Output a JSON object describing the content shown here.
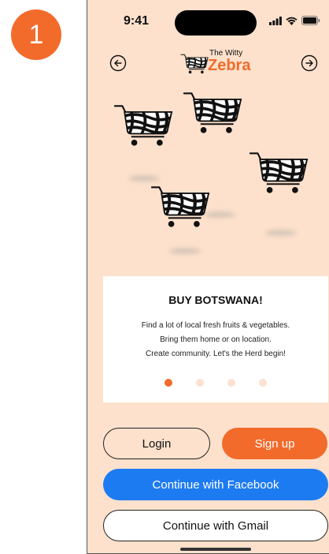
{
  "step_badge": {
    "number": "1",
    "color": "#f26b2b"
  },
  "status_bar": {
    "time": "9:41",
    "icons": [
      "signal-icon",
      "wifi-icon",
      "battery-icon"
    ]
  },
  "nav": {
    "back_icon": "arrow-left-circle-icon",
    "forward_icon": "arrow-right-circle-icon"
  },
  "logo": {
    "small_text": "The Witty",
    "big_text": "Zebra",
    "icon": "zebra-cart-icon",
    "accent": "#f26b2b"
  },
  "illustration": {
    "icon": "zebra-striped-shopping-cart-icon"
  },
  "card": {
    "title": "BUY BOTSWANA!",
    "lines": [
      "Find a lot of local fresh fruits & vegetables.",
      "Bring them home or on location.",
      "Create community.  Let's the Herd begin!"
    ],
    "pagination": {
      "active_index": 0,
      "total": 4
    }
  },
  "buttons": {
    "login": "Login",
    "signup": "Sign up",
    "facebook": "Continue with Facebook",
    "gmail": "Continue with Gmail"
  },
  "colors": {
    "background": "#fde1cc",
    "accent": "#f26b2b",
    "facebook": "#1d7bf2"
  }
}
